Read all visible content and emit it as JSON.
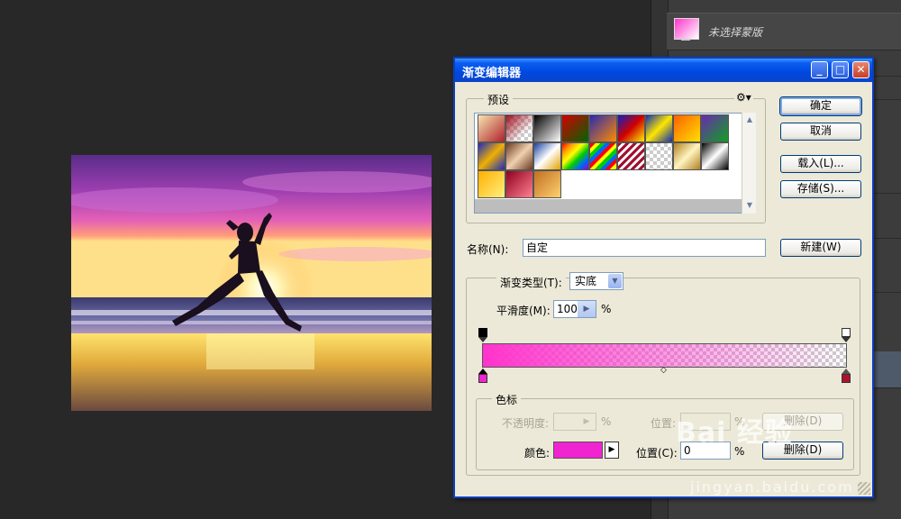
{
  "layers_panel": {
    "layer_name": "未选择蒙版"
  },
  "dialog": {
    "title": "渐变编辑器",
    "presets_label": "预设",
    "buttons": {
      "ok": "确定",
      "cancel": "取消",
      "load": "载入(L)...",
      "save": "存储(S)...",
      "new": "新建(W)"
    },
    "name_label": "名称(N):",
    "name_value": "自定",
    "gradient_type_label": "渐变类型(T):",
    "gradient_type_value": "实底",
    "smoothness_label": "平滑度(M):",
    "smoothness_value": "100",
    "percent": "%",
    "stops_group_label": "色标",
    "opacity_label": "不透明度:",
    "opacity_percent": "%",
    "opacity_position_label": "位置:",
    "opacity_position_percent": "%",
    "delete_label": "删除(D)",
    "color_label": "颜色:",
    "color_position_label": "位置(C):",
    "color_position_value": "0",
    "color_position_percent": "%",
    "color_delete_label": "删除(D)"
  },
  "gradient_colors": {
    "start": "#ff33cc",
    "end": "transparent",
    "color_stop": "#f024d0"
  },
  "watermark": {
    "brand": "Bai 经验",
    "url": "jingyan.baidu.com"
  }
}
